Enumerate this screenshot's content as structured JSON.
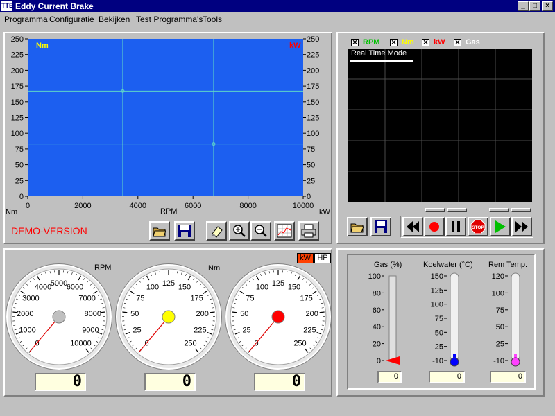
{
  "window": {
    "title": "Eddy Current Brake",
    "logo": "TTE",
    "btn_min": "_",
    "btn_max": "□",
    "btn_close": "×"
  },
  "menu": [
    "Programma",
    "Configuratie",
    "Bekijken",
    "Test Programma's",
    "Tools"
  ],
  "chart": {
    "left_unit": "Nm",
    "right_unit": "kW",
    "x_label": "RPM",
    "bottom_left_unit": "Nm",
    "bottom_right_unit": "kW",
    "background": "#1c5ff0",
    "grid_color": "#5fd6c8"
  },
  "chart_data": {
    "type": "line",
    "y_ticks": [
      "250",
      "225",
      "200",
      "175",
      "150",
      "125",
      "100",
      "75",
      "50",
      "25",
      "0"
    ],
    "x_ticks": [
      "0",
      "2000",
      "4000",
      "6000",
      "8000",
      "10000"
    ],
    "ylim": [
      0,
      250
    ],
    "xlim": [
      0,
      10000
    ],
    "crosshairs": [
      {
        "x": 3450,
        "y": 167
      },
      {
        "x": 6750,
        "y": 83
      }
    ]
  },
  "demo_label": "DEMO-VERSION",
  "chart_toolbar": [
    "open-folder-icon",
    "save-disk-icon",
    "eraser-icon",
    "zoom-in-icon",
    "zoom-out-icon",
    "chart-view-icon",
    "print-icon"
  ],
  "realtime": {
    "legend": [
      {
        "label": "RPM",
        "color": "#00c000"
      },
      {
        "label": "Nm",
        "color": "#ffff00"
      },
      {
        "label": "kW",
        "color": "#ff0000"
      },
      {
        "label": "Gas",
        "color": "#ffffff"
      }
    ],
    "mode_label": "Real Time Mode"
  },
  "playback_toolbar": [
    "open-folder-icon",
    "save-disk-icon",
    "rewind-icon",
    "record-icon",
    "pause-icon",
    "stop-icon",
    "play-icon",
    "fast-forward-icon"
  ],
  "playback_stop_text": "STOP",
  "units": {
    "kw": "kW",
    "hp": "HP"
  },
  "gauges": [
    {
      "unit": "RPM",
      "labels": [
        "0",
        "1000",
        "2000",
        "3000",
        "4000",
        "5000",
        "6000",
        "7000",
        "8000",
        "9000",
        "10000"
      ],
      "value": 0,
      "display": "0",
      "knob": "#c0c0c0"
    },
    {
      "unit": "Nm",
      "labels": [
        "0",
        "25",
        "50",
        "75",
        "100",
        "125",
        "150",
        "175",
        "200",
        "225",
        "250"
      ],
      "value": 0,
      "display": "0",
      "knob": "#ffff00"
    },
    {
      "unit": "",
      "labels": [
        "0",
        "25",
        "50",
        "75",
        "100",
        "125",
        "150",
        "175",
        "200",
        "225",
        "250"
      ],
      "value": 0,
      "display": "0",
      "knob": "#ff0000"
    }
  ],
  "thermometers": [
    {
      "title": "Gas (%)",
      "ticks": [
        "100",
        "80",
        "60",
        "40",
        "20",
        "0"
      ],
      "value": "0",
      "color": "#ff0000"
    },
    {
      "title": "Koelwater (°C)",
      "ticks": [
        "150",
        "125",
        "100",
        "75",
        "50",
        "25",
        "-10"
      ],
      "value": "0",
      "color": "#0000ff"
    },
    {
      "title": "Rem Temp.",
      "ticks": [
        "120",
        "100",
        "75",
        "50",
        "25",
        "-10"
      ],
      "value": "0",
      "color": "#ff40ff"
    }
  ]
}
